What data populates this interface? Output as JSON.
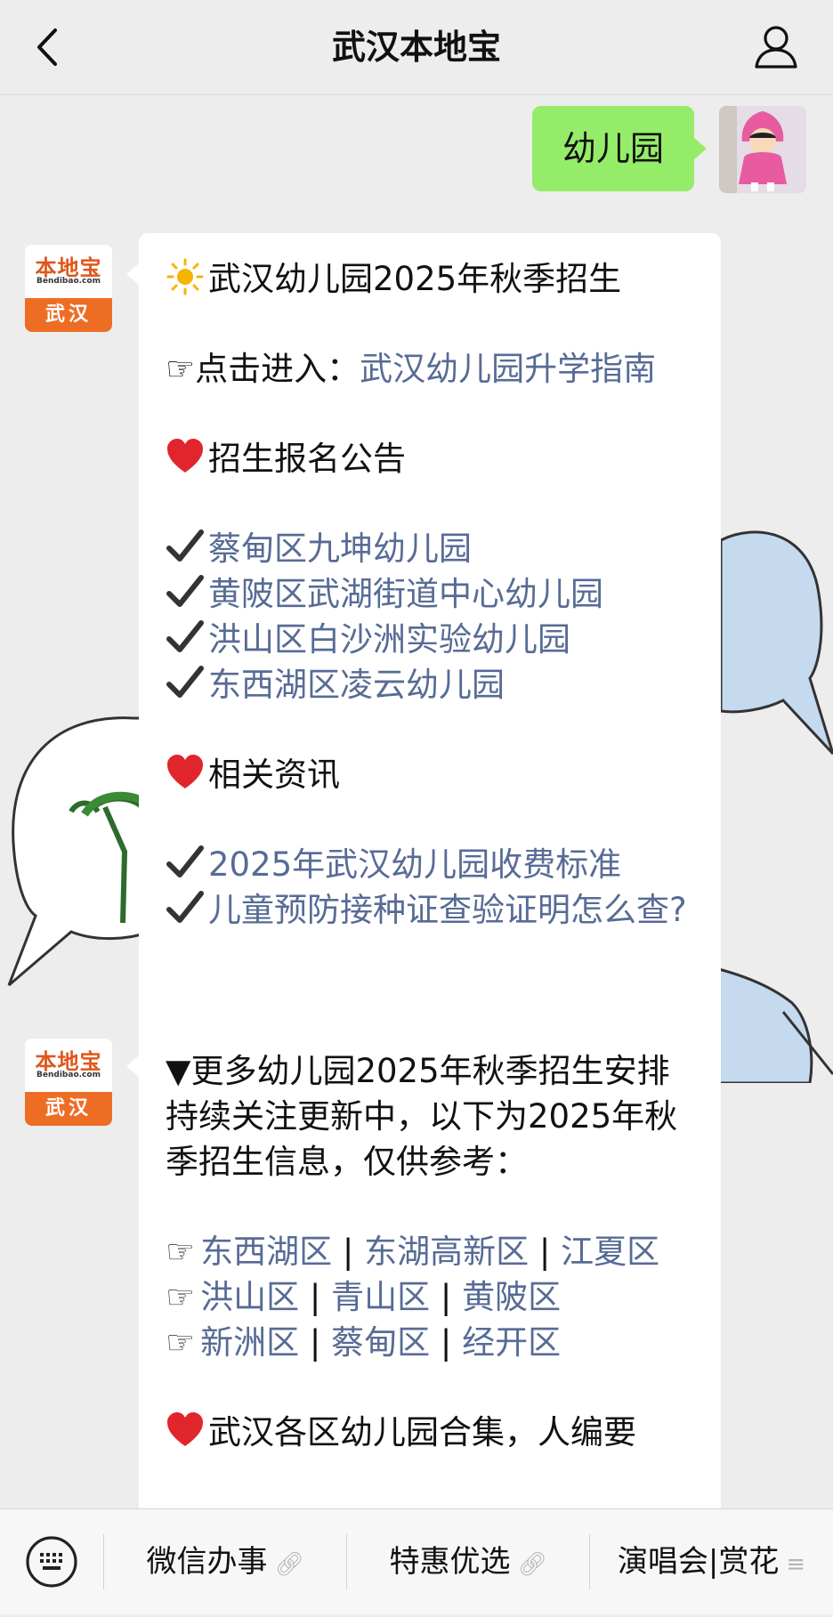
{
  "header": {
    "title": "武汉本地宝"
  },
  "user_message": {
    "text": "幼儿园"
  },
  "bot_avatar": {
    "brand": "本地宝",
    "domain": "Bendibao.com",
    "city": "武汉"
  },
  "message1": {
    "title": "武汉幼儿园2025年秋季招生",
    "guide_prefix": "☞点击进入：",
    "guide_link": "武汉幼儿园升学指南",
    "section1_title": "招生报名公告",
    "notices": [
      "蔡甸区九坤幼儿园",
      "黄陂区武湖街道中心幼儿园",
      "洪山区白沙洲实验幼儿园",
      "东西湖区凌云幼儿园"
    ],
    "section2_title": "相关资讯",
    "news": [
      "2025年武汉幼儿园收费标准",
      "儿童预防接种证查验证明怎么查?"
    ]
  },
  "message2": {
    "intro": "▼更多幼儿园2025年秋季招生安排持续关注更新中，以下为2025年秋季招生信息，仅供参考：",
    "hand": "☞",
    "sep": " | ",
    "row1": [
      "东西湖区",
      "东湖高新区",
      "江夏区"
    ],
    "row2": [
      "洪山区",
      "青山区",
      "黄陂区"
    ],
    "row3": [
      "新洲区",
      "蔡甸区",
      "经开区"
    ],
    "cut_line": "武汉各区幼儿园合集，人编要"
  },
  "menu": {
    "items": [
      {
        "label": "微信办事",
        "icon": "link-icon"
      },
      {
        "label": "特惠优选",
        "icon": "link-icon"
      },
      {
        "label": "演唱会|赏花",
        "icon": "menu-icon"
      }
    ]
  },
  "colors": {
    "link": "#576b95",
    "user_bubble": "#95ec69",
    "brand_orange": "#ee6d25",
    "background": "#ededed"
  }
}
